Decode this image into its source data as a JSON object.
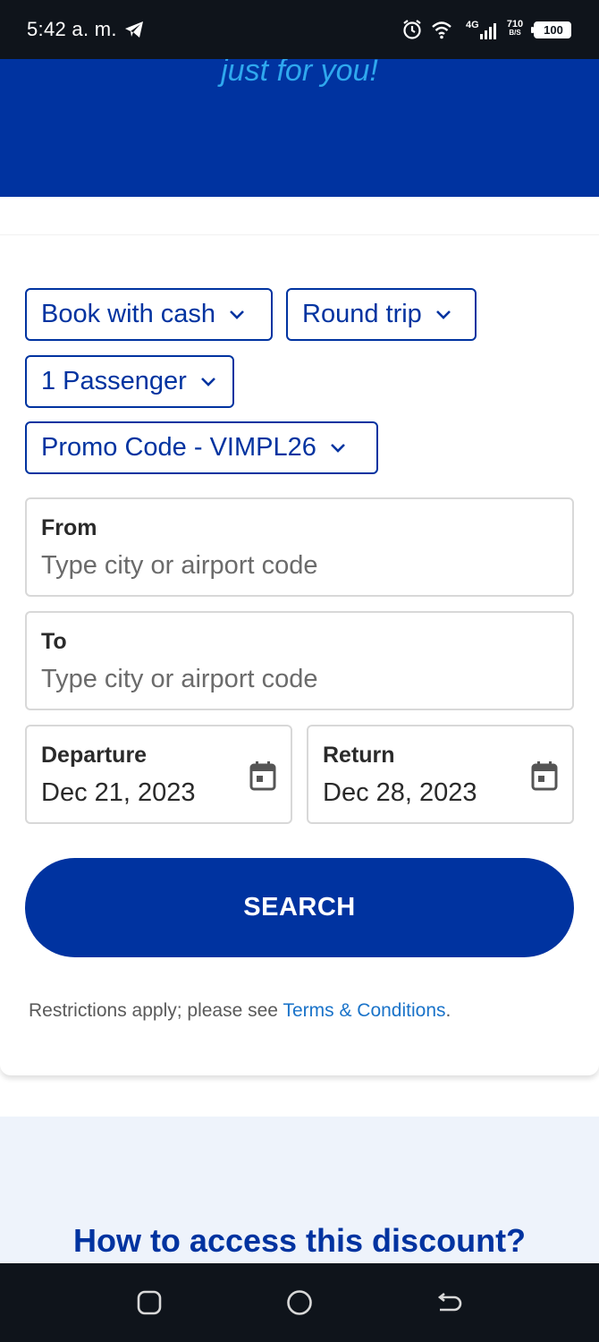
{
  "status_bar": {
    "time": "5:42 a. m.",
    "network": "4G",
    "speed_value": "710",
    "speed_unit": "B/S",
    "battery": "100"
  },
  "hero": {
    "tagline": "just for you!"
  },
  "booking": {
    "payment_dropdown": "Book with cash",
    "trip_dropdown": "Round trip",
    "passenger_dropdown": "1 Passenger",
    "promo_dropdown": "Promo Code - VIMPL26",
    "from_label": "From",
    "from_placeholder": "Type city or airport code",
    "to_label": "To",
    "to_placeholder": "Type city or airport code",
    "departure_label": "Departure",
    "departure_value": "Dec 21, 2023",
    "return_label": "Return",
    "return_value": "Dec 28, 2023",
    "search_label": "SEARCH",
    "restrictions_text": "Restrictions apply; please see ",
    "terms_link": "Terms & Conditions",
    "restrictions_end": "."
  },
  "info": {
    "title": "How to access this discount?"
  },
  "colors": {
    "brand_blue": "#0033a0",
    "tagline_blue": "#2fa8ee",
    "link_blue": "#1a73c9"
  }
}
